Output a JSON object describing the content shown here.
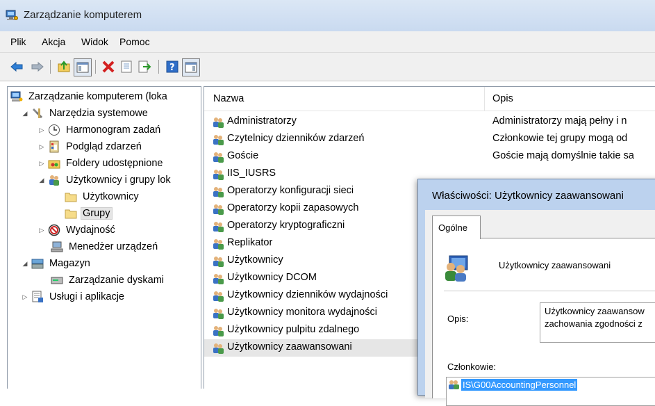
{
  "window": {
    "title": "Zarządzanie komputerem"
  },
  "menu": [
    "Plik",
    "Akcja",
    "Widok",
    "Pomoc"
  ],
  "toolbar": {
    "buttons": [
      "back-icon",
      "forward-icon",
      "up-folder-icon",
      "show-hide-tree-icon",
      "delete-icon",
      "properties-icon",
      "export-icon",
      "help-icon",
      "action-pane-icon"
    ]
  },
  "tree": [
    {
      "label": "Zarządzanie komputerem (loka",
      "icon": "computer-management-icon"
    },
    {
      "label": "Narzędzia systemowe",
      "icon": "system-tools-icon"
    },
    {
      "label": "Harmonogram zadań",
      "icon": "task-scheduler-icon"
    },
    {
      "label": "Podgląd zdarzeń",
      "icon": "event-viewer-icon"
    },
    {
      "label": "Foldery udostępnione",
      "icon": "shared-folders-icon"
    },
    {
      "label": "Użytkownicy i grupy lok",
      "icon": "users-groups-icon"
    },
    {
      "label": "Użytkownicy",
      "icon": "folder-icon"
    },
    {
      "label": "Grupy",
      "icon": "folder-icon"
    },
    {
      "label": "Wydajność",
      "icon": "performance-icon"
    },
    {
      "label": "Menedżer urządzeń",
      "icon": "device-manager-icon"
    },
    {
      "label": "Magazyn",
      "icon": "storage-icon"
    },
    {
      "label": "Zarządzanie dyskami",
      "icon": "disk-management-icon"
    },
    {
      "label": "Usługi i aplikacje",
      "icon": "services-apps-icon"
    }
  ],
  "list": {
    "columns": [
      "Nazwa",
      "Opis"
    ],
    "rows": [
      {
        "name": "Administratorzy",
        "desc": "Administratorzy mają pełny i n"
      },
      {
        "name": "Czytelnicy dzienników zdarzeń",
        "desc": "Członkowie tej grupy mogą od"
      },
      {
        "name": "Goście",
        "desc": "Goście mają domyślnie takie sa"
      },
      {
        "name": "IIS_IUSRS",
        "desc": ""
      },
      {
        "name": "Operatorzy konfiguracji sieci",
        "desc": ""
      },
      {
        "name": "Operatorzy kopii zapasowych",
        "desc": ""
      },
      {
        "name": "Operatorzy kryptograficzni",
        "desc": ""
      },
      {
        "name": "Replikator",
        "desc": ""
      },
      {
        "name": "Użytkownicy",
        "desc": ""
      },
      {
        "name": "Użytkownicy DCOM",
        "desc": ""
      },
      {
        "name": "Użytkownicy dzienników wydajności",
        "desc": ""
      },
      {
        "name": "Użytkownicy monitora wydajności",
        "desc": ""
      },
      {
        "name": "Użytkownicy pulpitu zdalnego",
        "desc": ""
      },
      {
        "name": "Użytkownicy zaawansowani",
        "desc": ""
      }
    ]
  },
  "dialog": {
    "title": "Właściwości: Użytkownicy zaawansowani",
    "tab": "Ogólne",
    "group_name": "Użytkownicy zaawansowani",
    "description_label": "Opis:",
    "description_line1": "Użytkownicy zaawansow",
    "description_line2": "zachowania zgodności z",
    "members_label": "Członkowie:",
    "members": [
      "IS\\G00AccountingPersonnel"
    ]
  }
}
